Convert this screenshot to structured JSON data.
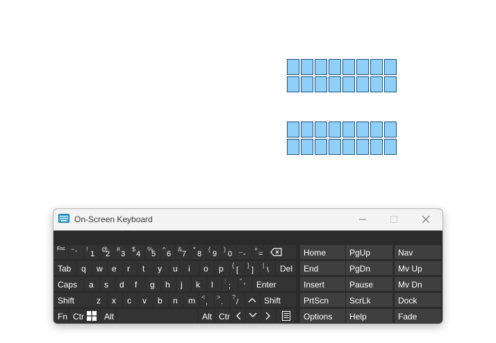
{
  "window": {
    "title": "On-Screen Keyboard",
    "minimize_label": "—",
    "maximize_label": "☐",
    "close_label": "✕"
  },
  "keys": {
    "esc": "Esc",
    "tilde": {
      "shift": "~",
      "main": "`"
    },
    "n1": {
      "shift": "!",
      "main": "1"
    },
    "n2": {
      "shift": "@",
      "main": "2"
    },
    "n3": {
      "shift": "#",
      "main": "3"
    },
    "n4": {
      "shift": "$",
      "main": "4"
    },
    "n5": {
      "shift": "%",
      "main": "5"
    },
    "n6": {
      "shift": "^",
      "main": "6"
    },
    "n7": {
      "shift": "&",
      "main": "7"
    },
    "n8": {
      "shift": "*",
      "main": "8"
    },
    "n9": {
      "shift": "(",
      "main": "9"
    },
    "n0": {
      "shift": ")",
      "main": "0"
    },
    "minus": {
      "shift": "_",
      "main": "-"
    },
    "equals": {
      "shift": "+",
      "main": "="
    },
    "tab": "Tab",
    "q": "q",
    "w": "w",
    "e": "e",
    "r": "r",
    "t": "t",
    "y": "y",
    "u": "u",
    "i": "i",
    "o": "o",
    "p": "p",
    "lbracket": {
      "shift": "{",
      "main": "["
    },
    "rbracket": {
      "shift": "}",
      "main": "]"
    },
    "backslash": {
      "shift": "|",
      "main": "\\"
    },
    "del": "Del",
    "caps": "Caps",
    "a": "a",
    "s": "s",
    "d": "d",
    "f": "f",
    "g": "g",
    "h": "h",
    "j": "j",
    "k": "k",
    "l": "l",
    "semicolon": {
      "shift": ":",
      "main": ";"
    },
    "quote": {
      "shift": "\"",
      "main": "'"
    },
    "enter": "Enter",
    "shift_left": "Shift",
    "z": "z",
    "x": "x",
    "c": "c",
    "v": "v",
    "b": "b",
    "n": "n",
    "m": "m",
    "comma": {
      "shift": "<",
      "main": ","
    },
    "period": {
      "shift": ">",
      "main": "."
    },
    "slash": {
      "shift": "?",
      "main": "/"
    },
    "shift_right": "Shift",
    "fn": "Fn",
    "ctrl_left": "Ctrl",
    "alt_left": "Alt",
    "alt_right": "Alt",
    "ctrl_right": "Ctrl",
    "home": "Home",
    "pgup": "PgUp",
    "navkey": "Nav",
    "end": "End",
    "pgdn": "PgDn",
    "mvup": "Mv Up",
    "insert": "Insert",
    "pause": "Pause",
    "mvdn": "Mv Dn",
    "prtscn": "PrtScn",
    "scrlk": "ScrLk",
    "dock": "Dock",
    "options": "Options",
    "help": "Help",
    "fade": "Fade"
  },
  "icons": {
    "backspace": "backspace-icon",
    "windows": "windows-logo-icon",
    "up": "arrow-up-icon",
    "down": "arrow-down-icon",
    "left": "arrow-left-icon",
    "right": "arrow-right-icon",
    "menu": "context-menu-icon",
    "app": "keyboard-app-icon"
  },
  "colors": {
    "cell_fill": "#8fd0fb",
    "cell_border": "#1f4f7a",
    "keyboard_bg": "#2b2b2b",
    "key_bg": "#333333"
  }
}
